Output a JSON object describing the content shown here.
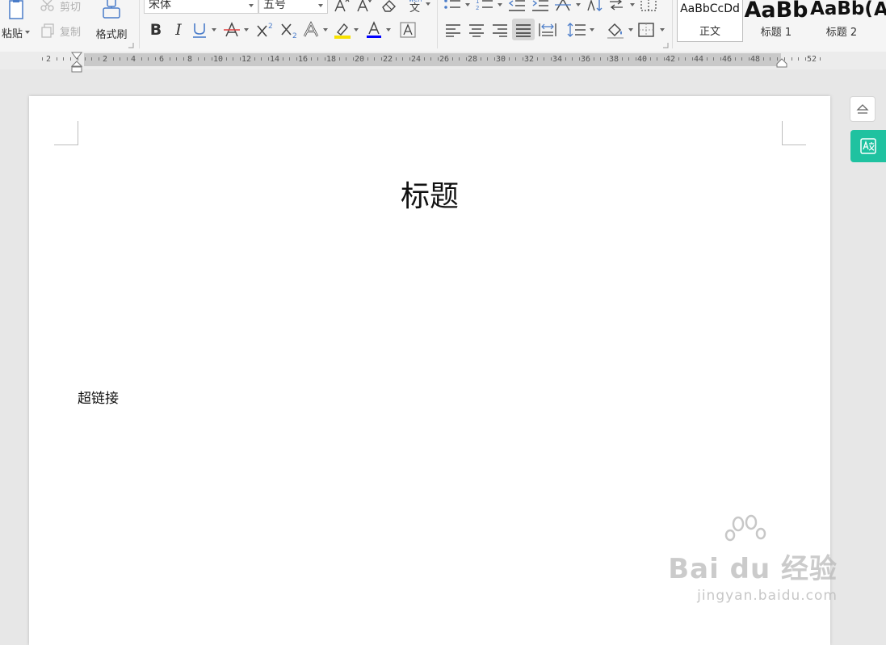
{
  "clipboard": {
    "paste_label": "粘贴",
    "cut_label": "剪切",
    "copy_label": "复制",
    "format_painter_label": "格式刷"
  },
  "font": {
    "family": "宋体",
    "size": "五号"
  },
  "styles": [
    {
      "preview": "AaBbCcDd",
      "name": "正文"
    },
    {
      "preview": "AaBb",
      "name": "标题 1"
    },
    {
      "preview": "AaBb(",
      "name": "标题 2"
    },
    {
      "preview": "A",
      "name": ""
    }
  ],
  "ruler": {
    "labels": [
      "2",
      "2",
      "4",
      "6",
      "8",
      "10",
      "12",
      "14",
      "16",
      "18",
      "20",
      "22",
      "24",
      "26",
      "28",
      "30",
      "32",
      "34",
      "36",
      "38",
      "40",
      "42",
      "44",
      "46",
      "48",
      "52"
    ]
  },
  "document": {
    "title": "标题",
    "body_text": "超链接"
  },
  "watermark": {
    "brand": "Bai du 经验",
    "url": "jingyan.baidu.com"
  },
  "colors": {
    "accent": "#1fc2a0",
    "highlight": "#f7e100",
    "font_color": "#0000ff",
    "underline_red": "#e04040"
  }
}
